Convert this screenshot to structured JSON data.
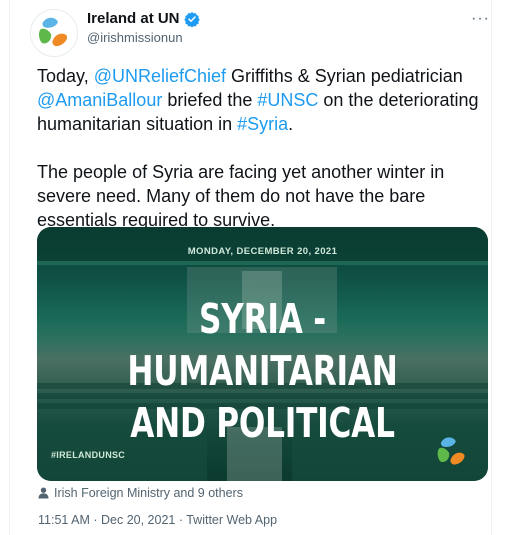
{
  "author": {
    "display_name": "Ireland at UN",
    "handle": "@irishmissionun"
  },
  "tweet": {
    "line1_a": "Today, ",
    "mention1": "@UNReliefChief",
    "line1_b": " Griffiths & Syrian pediatrician ",
    "mention2": "@AmaniBallour",
    "line1_c": " briefed the ",
    "hashtag1": "#UNSC",
    "line1_d": " on the deteriorating humanitarian situation in ",
    "hashtag2": "#Syria",
    "line1_e": ".",
    "paragraph2": "The people of Syria are facing yet another winter in severe need. Many of them do not have the bare essentials required to survive."
  },
  "media": {
    "date": "MONDAY, DECEMBER 20, 2021",
    "title_line1": "SYRIA - HUMANITARIAN",
    "title_line2": "AND POLITICAL",
    "hashtag": "#IRELANDUNSC"
  },
  "tagged": "Irish Foreign Ministry and 9 others",
  "timestamp": "11:51 AM · Dec 20, 2021 · Twitter Web App",
  "icons": {
    "avatar_logo": "ireland-un-logo",
    "verified": "verified-badge-icon",
    "more": "more-icon",
    "person": "person-icon"
  },
  "colors": {
    "link": "#1d9bf0",
    "secondary_text": "#536471",
    "verified_badge": "#1d9bf0",
    "logo_blue": "#5ab4e5",
    "logo_green": "#5fb84a",
    "logo_orange": "#f08a24"
  }
}
